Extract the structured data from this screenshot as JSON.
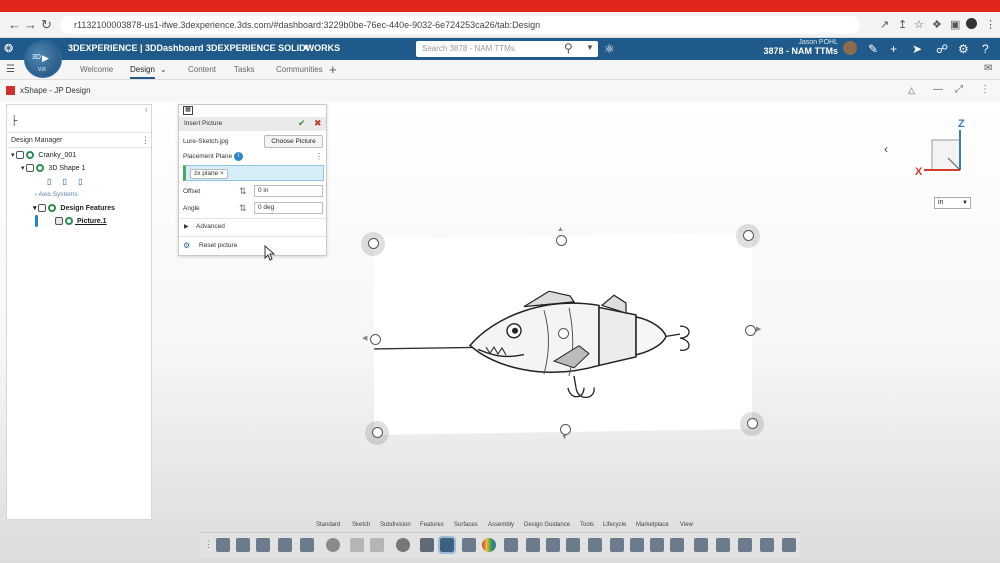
{
  "browser": {
    "url": "r1132100003878-us1-ifwe.3dexperience.3ds.com/#dashboard:3229b0be-76ec-440e-9032-6e724253ca26/tab:Design"
  },
  "app": {
    "title": "3DEXPERIENCE | 3DDashboard  3DEXPERIENCE SOLIDWORKS",
    "compass_version": "V.R",
    "search_placeholder": "Search 3878 - NAM TTMs",
    "user_name": "Jason POHL",
    "user_tenant": "3878 - NAM TTMs",
    "accent": "#1f5a8a"
  },
  "tabs": [
    "Welcome",
    "Design",
    "Content",
    "Tasks",
    "Communities"
  ],
  "workspace_title": "xShape - JP Design",
  "design_manager": {
    "label": "Design Manager",
    "tree": {
      "root": "Cranky_001",
      "shape": "3D Shape 1",
      "axis": "Axis Systems",
      "features": "Design Features",
      "picture": "Picture.1"
    }
  },
  "insert_picture": {
    "title": "Insert Picture",
    "file_name": "Lure-Sketch.jpg",
    "choose_button": "Choose Picture",
    "placement_label": "Placement Plane",
    "info_badge": "i",
    "plane_chip": "zx plane",
    "offset_label": "Offset",
    "offset_value": "0 in",
    "angle_label": "Angle",
    "angle_value": "0 deg",
    "advanced_label": "Advanced",
    "reset_label": "Reset picture"
  },
  "compass_cube": {
    "z": "Z",
    "x": "X"
  },
  "unit_select": "in",
  "action_tabs": [
    "Standard",
    "Sketch",
    "Subdivision",
    "Features",
    "Surfaces",
    "Assembly",
    "Design Guidance",
    "Tools",
    "Lifecycle",
    "Marketplace",
    "View"
  ]
}
